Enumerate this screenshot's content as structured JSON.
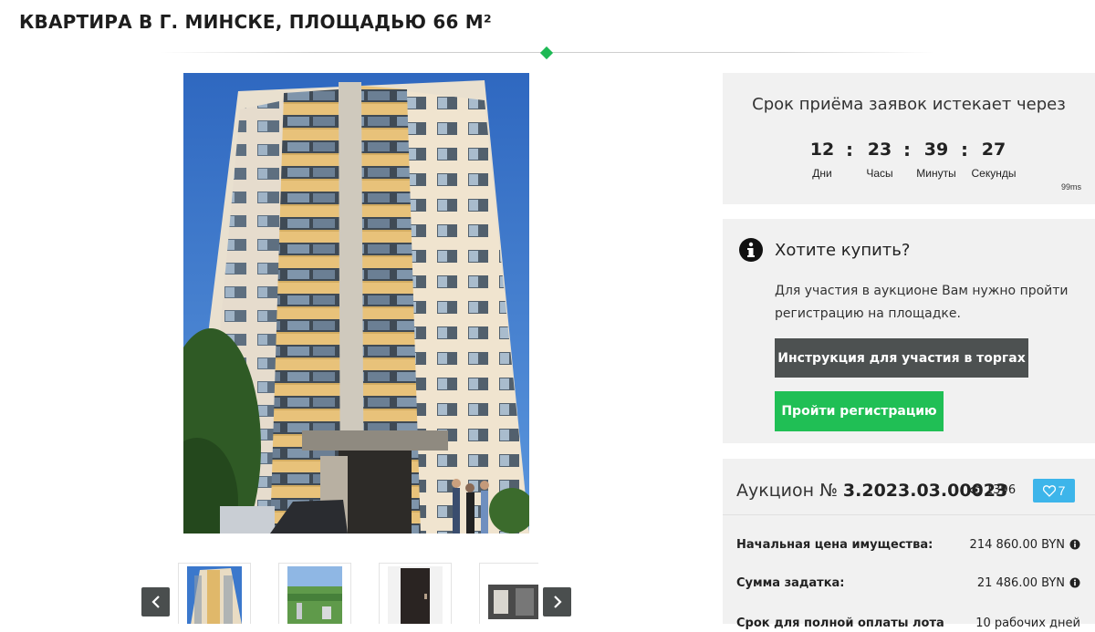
{
  "page": {
    "title": "КВАРТИРА В Г. МИНСКЕ, ПЛОЩАДЬЮ 66 М²"
  },
  "colors": {
    "accent_green": "#20bf55",
    "dark_button": "#4d5151",
    "like_blue": "#3db5ea",
    "panel_bg": "#f1f1f1"
  },
  "gallery": {
    "main_image_icon": "building-photo",
    "thumbnails": [
      {
        "name": "thumb-building-exterior"
      },
      {
        "name": "thumb-view-from-window"
      },
      {
        "name": "thumb-entrance-door"
      },
      {
        "name": "thumb-interior-room"
      }
    ],
    "prev_icon": "chevron-left-icon",
    "next_icon": "chevron-right-icon"
  },
  "countdown": {
    "title": "Срок приёма заявок истекает через",
    "days": "12",
    "days_label": "Дни",
    "hours": "23",
    "hours_label": "Часы",
    "minutes": "39",
    "minutes_label": "Минуты",
    "seconds": "27",
    "seconds_label": "Секунды",
    "separator": ":",
    "ms": "99ms"
  },
  "buy": {
    "title": "Хотите купить?",
    "text": "Для участия в аукционе Вам нужно пройти регистрацию на площадке.",
    "instruction_button": "Инструкция для участия в торгах",
    "register_button": "Пройти регистрацию"
  },
  "auction": {
    "prefix": "Аукцион №",
    "number": "3.2023.03.00023",
    "views": "1396",
    "likes": "7",
    "rows": [
      {
        "label": "Начальная цена имущества:",
        "value": "214 860.00 BYN"
      },
      {
        "label": "Сумма задатка:",
        "value": "21 486.00 BYN"
      },
      {
        "label": "Срок для полной оплаты лота",
        "value": "10 рабочих дней"
      }
    ]
  }
}
